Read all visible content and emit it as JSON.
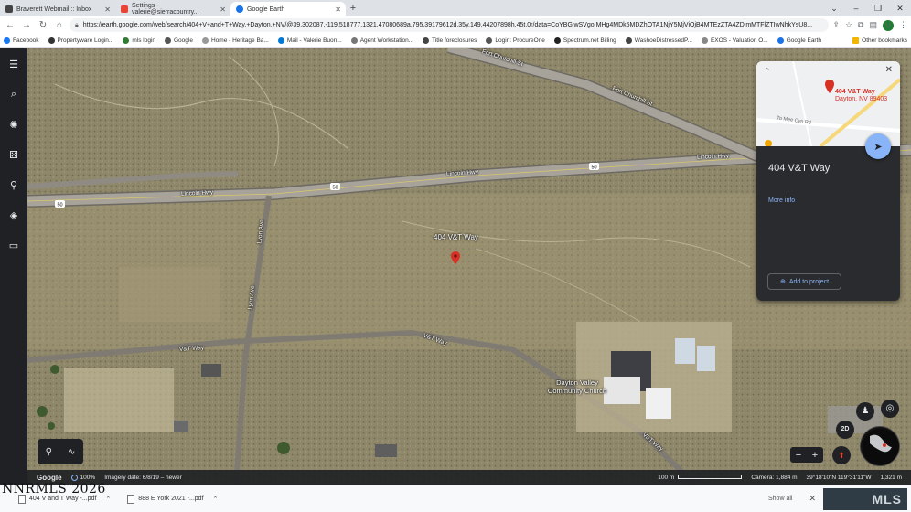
{
  "browser": {
    "tabs": [
      {
        "label": "Braverett Webmail :: Inbox",
        "favicon_color": "#444444"
      },
      {
        "label": "Settings - valerie@sierracountry...",
        "favicon_color": "#ea4335"
      },
      {
        "label": "Google Earth",
        "favicon_color": "#1a73e8"
      }
    ],
    "url": "https://earth.google.com/web/search/404+V+and+T+Way,+Dayton,+NV/@39.302087,-119.518777,1321.47080689a,795.39179612d,35y,149.44207898h,45t,0r/data=CoYBGlwSVgoIMHg4MDk5MDZhOTA1NjY5MjViOjB4MTEzZTA4ZDlmMTFlZTIwNhkYsU8...",
    "bookmarks": [
      "Facebook",
      "Propertyware Login...",
      "mls login",
      "Google",
      "Home - Heritage Ba...",
      "Mail - Valerie Buon...",
      "Agent Workstation...",
      "Title foreclosures",
      "Login: ProcureOne",
      "Spectrum.net Billing",
      "WashoeDistressedP...",
      "EXOS - Valuation O...",
      "Google Earth"
    ],
    "other_bookmarks": "Other bookmarks"
  },
  "sidebar": {
    "icons": [
      "menu-icon",
      "search-icon",
      "voyager-icon",
      "feeling-lucky-icon",
      "projects-icon",
      "map-style-icon",
      "measure-icon"
    ]
  },
  "map": {
    "placemark": "404 V&T Way",
    "church": "Dayton Valley\nCommunity Church",
    "roads": [
      "Lincoln Hwy",
      "Lincoln Hwy",
      "Lincoln Hwy",
      "Fort Churchill St",
      "Fort Churchill St",
      "V&T Way",
      "V&T Way",
      "V&T Way",
      "Lyon Ave",
      "Lyon Ave"
    ],
    "shields": [
      "50",
      "50",
      "50"
    ]
  },
  "card": {
    "map_address_line1": "404 V&T Way",
    "map_address_line2": "Dayton, NV 89403",
    "map_street": "To Mee Cyn Rd",
    "title": "404 V&T Way",
    "more_info": "More info",
    "add_to_project": "Add to project"
  },
  "controls": {
    "two_d": "2D",
    "zoom_out": "−",
    "zoom_in": "+"
  },
  "status": {
    "brand": "Google",
    "zoom": "100%",
    "imagery_date": "Imagery date: 6/8/19 – newer",
    "scale": "100 m",
    "camera": "Camera: 1,884 m",
    "coords": "39°18'10\"N 119°31'11\"W",
    "elevation": "1,321 m"
  },
  "downloads": [
    {
      "label": "404 V and T Way -...pdf"
    },
    {
      "label": "888 E York 2021 -...pdf"
    }
  ],
  "download_show_all": "Show all",
  "watermark": "NNRMLS 2026",
  "logo_text": "MLS",
  "colors": {
    "terrain": "#8c8466",
    "road": "#9a968c",
    "pin": "#d93025",
    "accent": "#8ab4f8",
    "panel": "#2a2b2e"
  }
}
